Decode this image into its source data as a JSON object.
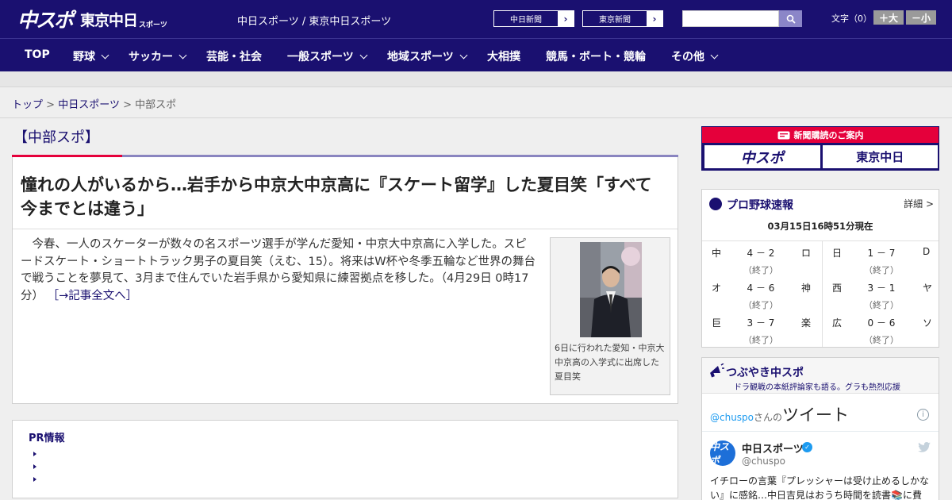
{
  "header": {
    "logo_chuspo": "中スポ",
    "logo_tokyo": "東京中日",
    "logo_sports": "スポーツ",
    "site_links": "中日スポーツ / 東京中日スポーツ",
    "paper_buttons": [
      "中日新聞",
      "東京新聞"
    ],
    "search_placeholder": "",
    "fontsize_label": "文字（0）",
    "fontsize_plus": "＋大",
    "fontsize_minus": "－小"
  },
  "nav": {
    "items": [
      "TOP",
      "野球",
      "サッカー",
      "芸能・社会",
      "一般スポーツ",
      "地域スポーツ",
      "大相撲",
      "競馬・ボート・競輪",
      "その他"
    ]
  },
  "breadcrumb": {
    "items": [
      "トップ",
      "中日スポーツ",
      "中部スポ"
    ],
    "separator": ">"
  },
  "section": {
    "title": "【中部スポ】"
  },
  "article": {
    "headline": "憧れの人がいるから…岩手から中京大中京高に『スケート留学』した夏目笑「すべて今までとは違う」",
    "body": "今春、一人のスケーターが数々の名スポーツ選手が学んだ愛知・中京大中京高に入学した。スピードスケート・ショートトラック男子の夏目笑（えむ、15）。将来はW杯や冬季五輪など世界の舞台で戦うことを夢見て、3月まで住んでいた岩手県から愛知県に練習拠点を移した。（4月29日 0時17分）",
    "read_more": "［→記事全文へ］",
    "photo_caption": "6日に行われた愛知・中京大中京高の入学式に出席した夏目笑"
  },
  "pr": {
    "title": "PR情報"
  },
  "sidebar": {
    "subscribe": {
      "title": "新聞購読のご案内",
      "buttons": [
        "中スポ",
        "東京中日"
      ]
    },
    "baseball": {
      "title": "プロ野球速報",
      "detail": "詳細 >",
      "time": "03月15日16時51分現在",
      "games": [
        {
          "home": "中",
          "score": "4 － 2",
          "status": "（終了）",
          "away": "ロ"
        },
        {
          "home": "日",
          "score": "1 － 7",
          "status": "（終了）",
          "away": "D"
        },
        {
          "home": "オ",
          "score": "4 － 6",
          "status": "（終了）",
          "away": "神"
        },
        {
          "home": "西",
          "score": "3 － 1",
          "status": "（終了）",
          "away": "ヤ"
        },
        {
          "home": "巨",
          "score": "3 － 7",
          "status": "（終了）",
          "away": "楽"
        },
        {
          "home": "広",
          "score": "0 － 6",
          "status": "（終了）",
          "away": "ソ"
        }
      ]
    },
    "tweet": {
      "title": "つぶやき中スポ",
      "subtitle": "ドラ観戦の本紙評論家も語る。グラも熱烈応援",
      "handle_link": "@chuspo",
      "san_no": "さんの",
      "tweets_label": "ツイート",
      "avatar_text": "中スポ",
      "name": "中日スポーツ",
      "handle": "@chuspo",
      "text": "イチローの言葉『プレッシャーは受け止めるしかない』に感銘…中日吉見はおうち時間を読書📚に費"
    }
  },
  "colors": {
    "brand_navy": "#1a1070",
    "accent_red": "#e5003b",
    "twitter_blue": "#1d9bf0"
  }
}
